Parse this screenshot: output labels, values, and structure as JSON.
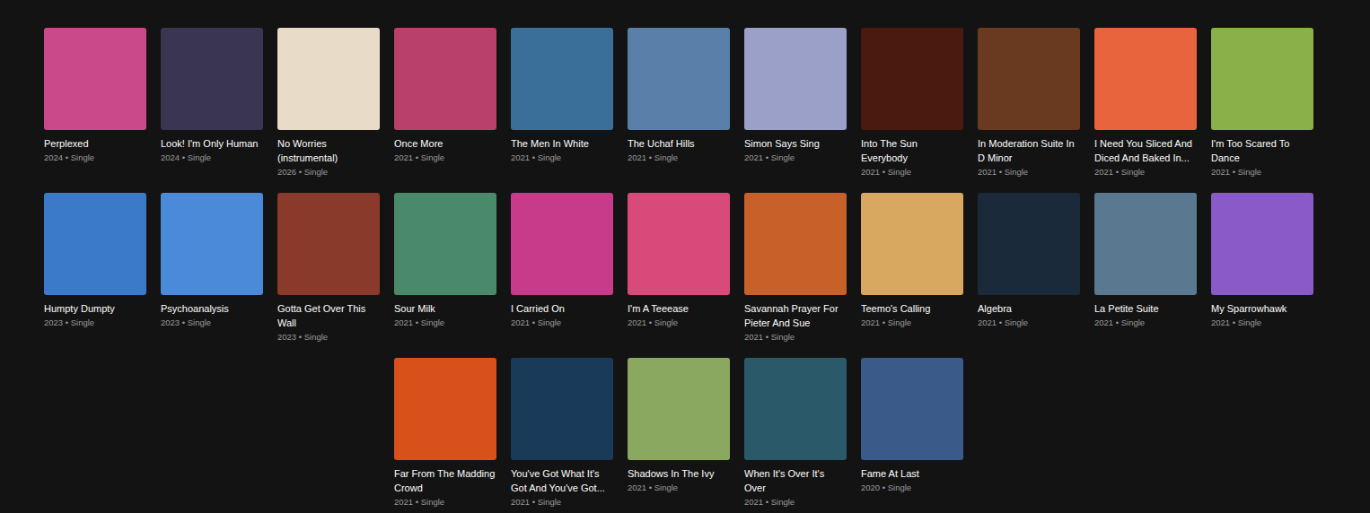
{
  "discography": {
    "rows": [
      [
        {
          "title": "Perplexed",
          "meta": "2024 • Single",
          "color": "#c94a8a"
        },
        {
          "title": "Look! I'm Only Human",
          "meta": "2024 • Single",
          "color": "#3a3550"
        },
        {
          "title": "No Worries (instrumental)",
          "meta": "2026 • Single",
          "color": "#e8dcc8"
        },
        {
          "title": "Once More",
          "meta": "2021 • Single",
          "color": "#b8406a"
        },
        {
          "title": "The Men In White",
          "meta": "2021 • Single",
          "color": "#3a6f9a"
        },
        {
          "title": "The Uchaf Hills",
          "meta": "2021 • Single",
          "color": "#5a7fa8"
        },
        {
          "title": "Simon Says Sing",
          "meta": "2021 • Single",
          "color": "#9aa0c8"
        },
        {
          "title": "Into The Sun Everybody",
          "meta": "2021 • Single",
          "color": "#4a1a10"
        },
        {
          "title": "In Moderation Suite In D Minor",
          "meta": "2021 • Single",
          "color": "#6a3a20"
        },
        {
          "title": "I Need You Sliced And Diced And Baked In...",
          "meta": "2021 • Single",
          "color": "#e8643c"
        },
        {
          "title": "I'm Too Scared To Dance",
          "meta": "2021 • Single",
          "color": "#8ab04a"
        }
      ],
      [
        {
          "title": "Humpty Dumpty",
          "meta": "2023 • Single",
          "color": "#3a7ac8"
        },
        {
          "title": "Psychoanalysis",
          "meta": "2023 • Single",
          "color": "#4a8ad8"
        },
        {
          "title": "Gotta Get Over This Wall",
          "meta": "2023 • Single",
          "color": "#8a3a2a"
        },
        {
          "title": "Sour Milk",
          "meta": "2021 • Single",
          "color": "#4a8a6a"
        },
        {
          "title": "I Carried On",
          "meta": "2021 • Single",
          "color": "#c83a8a"
        },
        {
          "title": "I'm A Teeease",
          "meta": "2021 • Single",
          "color": "#d84a7a"
        },
        {
          "title": "Savannah Prayer For Pieter And Sue",
          "meta": "2021 • Single",
          "color": "#c8602a"
        },
        {
          "title": "Teemo's Calling",
          "meta": "2021 • Single",
          "color": "#d8a860"
        },
        {
          "title": "Algebra",
          "meta": "2021 • Single",
          "color": "#1a2a3a"
        },
        {
          "title": "La Petite Suite",
          "meta": "2021 • Single",
          "color": "#5a7890"
        },
        {
          "title": "My Sparrowhawk",
          "meta": "2021 • Single",
          "color": "#8a5ac8"
        }
      ],
      [
        {
          "title": "Far From The Madding Crowd",
          "meta": "2021 • Single",
          "color": "#d8501a"
        },
        {
          "title": "You've Got What It's Got And You've Got...",
          "meta": "2021 • Single",
          "color": "#1a3a5a"
        },
        {
          "title": "Shadows In The Ivy",
          "meta": "2021 • Single",
          "color": "#8aa860"
        },
        {
          "title": "When It's Over It's Over",
          "meta": "2021 • Single",
          "color": "#2a5a6a"
        },
        {
          "title": "Fame At Last",
          "meta": "2020 • Single",
          "color": "#3a5a8a"
        }
      ]
    ]
  }
}
